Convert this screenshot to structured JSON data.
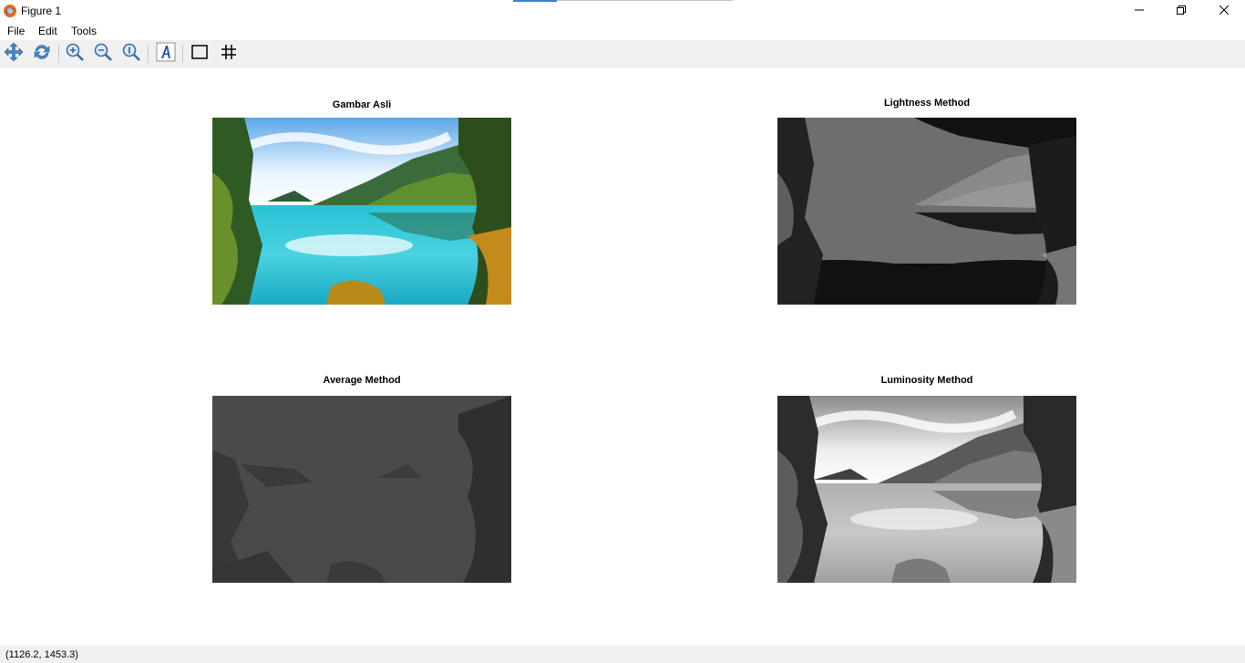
{
  "window": {
    "title": "Figure 1",
    "icons": {
      "app": "matlab-figure-icon",
      "minimize": "minimize-icon",
      "maximize": "restore-icon",
      "close": "close-icon"
    }
  },
  "menu": {
    "items": [
      "File",
      "Edit",
      "Tools"
    ]
  },
  "toolbar": {
    "tools": [
      "pan-icon",
      "rotate-icon",
      "zoom-in-icon",
      "zoom-out-icon",
      "zoom-reset-icon",
      "text-annotation-icon",
      "box-icon",
      "grid-icon"
    ]
  },
  "plots": [
    {
      "title": "Gambar Asli",
      "image": "lake landscape original color"
    },
    {
      "title": "Lightness Method",
      "image": "lake landscape grayscale lightness"
    },
    {
      "title": "Average Method",
      "image": "lake landscape grayscale average"
    },
    {
      "title": "Luminosity Method",
      "image": "lake landscape grayscale luminosity"
    }
  ],
  "status": {
    "coords": "(1126.2, 1453.3)"
  },
  "colors": {
    "toolbar_bg": "#f0f0f0",
    "canvas_bg": "#ffffff",
    "accent": "#3c7fd6"
  }
}
